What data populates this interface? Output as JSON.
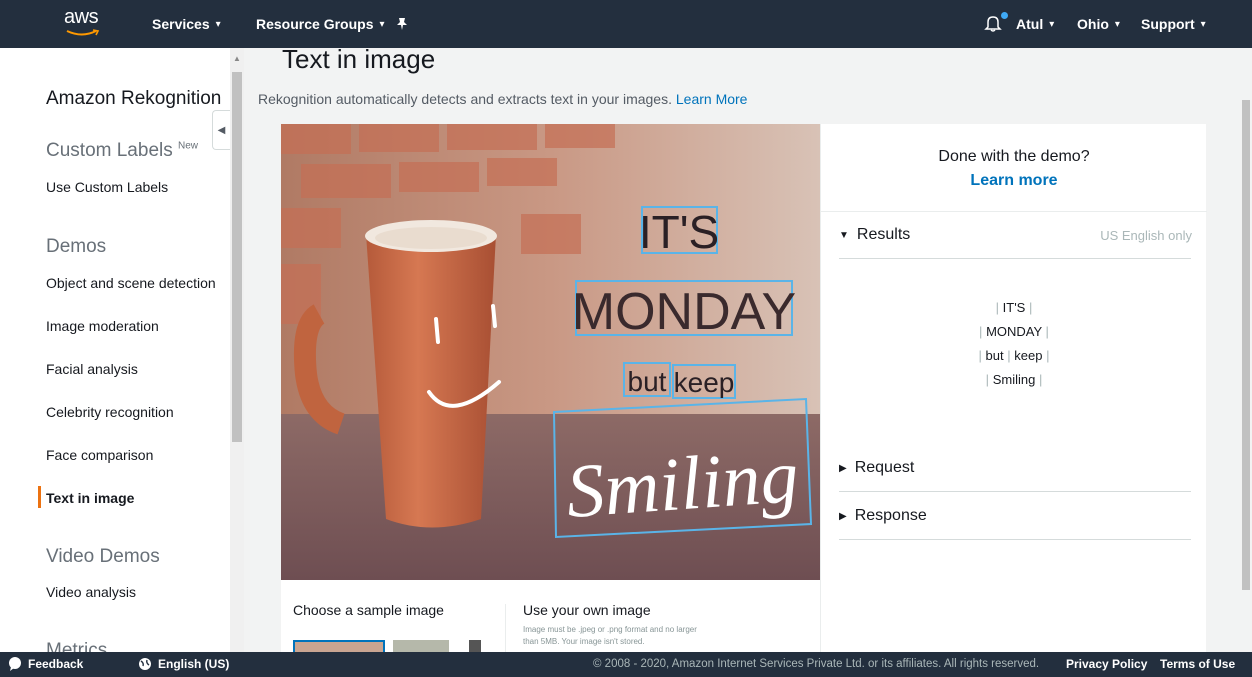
{
  "topnav": {
    "logo": "aws",
    "services": "Services",
    "resource_groups": "Resource Groups",
    "user": "Atul",
    "region": "Ohio",
    "support": "Support"
  },
  "sidebar": {
    "title": "Amazon Rekognition",
    "custom_labels_section": "Custom Labels",
    "new_badge": "New",
    "use_custom_labels": "Use Custom Labels",
    "demos_section": "Demos",
    "demos": [
      "Object and scene detection",
      "Image moderation",
      "Facial analysis",
      "Celebrity recognition",
      "Face comparison",
      "Text in image"
    ],
    "video_section": "Video Demos",
    "video_analysis": "Video analysis",
    "metrics_section": "Metrics"
  },
  "main": {
    "title": "Text in image",
    "description": "Rekognition automatically detects and extracts text in your images.",
    "learn_more_link": "Learn More",
    "image_words": [
      "IT'S",
      "MONDAY",
      "but",
      "keep",
      "Smiling"
    ],
    "choose_sample": "Choose a sample image",
    "use_own": "Use your own image",
    "own_note": "Image must be .jpeg or .png format and no larger than 5MB. Your image isn't stored."
  },
  "right_panel": {
    "done_text": "Done with the demo?",
    "learn_more": "Learn more",
    "results_label": "Results",
    "us_english": "US English only",
    "results": {
      "line1": "IT'S",
      "line2": "MONDAY",
      "line3a": "but",
      "line3b": "keep",
      "line4": "Smiling"
    },
    "request_label": "Request",
    "response_label": "Response"
  },
  "footer": {
    "feedback": "Feedback",
    "language": "English (US)",
    "copyright": "© 2008 - 2020, Amazon Internet Services Private Ltd. or its affiliates. All rights reserved.",
    "privacy": "Privacy Policy",
    "terms": "Terms of Use"
  },
  "colors": {
    "nav_bg": "#232f3e",
    "accent_orange": "#ec7211",
    "link_blue": "#0073bb",
    "box_blue": "#5ab4e8"
  }
}
